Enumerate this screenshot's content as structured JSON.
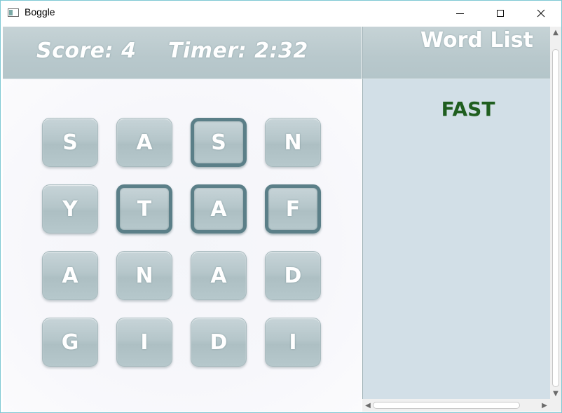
{
  "window": {
    "title": "Boggle"
  },
  "controls": {
    "minimize": "minimize-icon",
    "maximize": "maximize-icon",
    "close": "close-icon"
  },
  "hud": {
    "score_text": "Score: 4",
    "timer_text": "Timer: 2:32"
  },
  "board": {
    "tiles": [
      {
        "letter": "S",
        "selected": false
      },
      {
        "letter": "A",
        "selected": false
      },
      {
        "letter": "S",
        "selected": true
      },
      {
        "letter": "N",
        "selected": false
      },
      {
        "letter": "Y",
        "selected": false
      },
      {
        "letter": "T",
        "selected": true
      },
      {
        "letter": "A",
        "selected": true
      },
      {
        "letter": "F",
        "selected": true
      },
      {
        "letter": "A",
        "selected": false
      },
      {
        "letter": "N",
        "selected": false
      },
      {
        "letter": "A",
        "selected": false
      },
      {
        "letter": "D",
        "selected": false
      },
      {
        "letter": "G",
        "selected": false
      },
      {
        "letter": "I",
        "selected": false
      },
      {
        "letter": "D",
        "selected": false
      },
      {
        "letter": "I",
        "selected": false
      }
    ]
  },
  "word_list": {
    "title": "Word List",
    "words": [
      "FAST"
    ]
  },
  "colors": {
    "panel": "#b8c8cc",
    "word_found": "#1f5e1f",
    "selected_border": "#5b7f88",
    "list_bg": "#d2dfe7"
  }
}
